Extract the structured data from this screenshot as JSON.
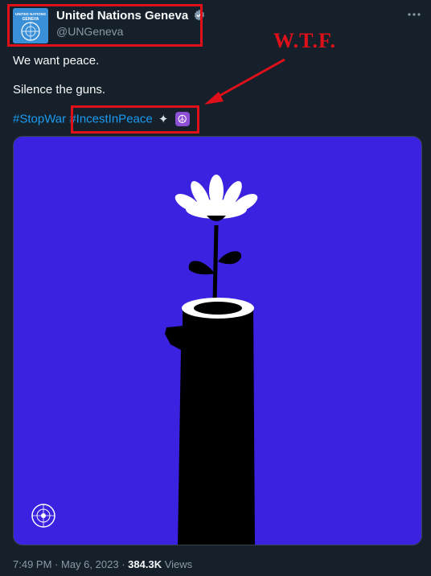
{
  "account": {
    "name": "United Nations Geneva",
    "handle": "@UNGeneva",
    "avatar_text": "UNITED NATIONS GENEVA"
  },
  "menu_icon": "more-horizontal-icon",
  "annotation": {
    "text": "W.T.F.",
    "color": "#e0101a"
  },
  "tweet": {
    "line1": "We want peace.",
    "line2": "Silence the guns.",
    "hashtag1": "#StopWar",
    "hashtag2": "#IncestInPeace",
    "emojis": [
      "dove-icon",
      "peace-symbol-icon"
    ]
  },
  "media": {
    "background": "#3a22e0",
    "description_icons": [
      "flower-icon",
      "un-emblem-icon"
    ]
  },
  "footer": {
    "time": "7:49 PM",
    "separator": "·",
    "date": "May 6, 2023",
    "views_count": "384.3K",
    "views_label": "Views"
  },
  "colors": {
    "background": "#15202b",
    "link": "#1d9bf0",
    "muted": "#8b98a5",
    "highlight": "#e0101a"
  }
}
